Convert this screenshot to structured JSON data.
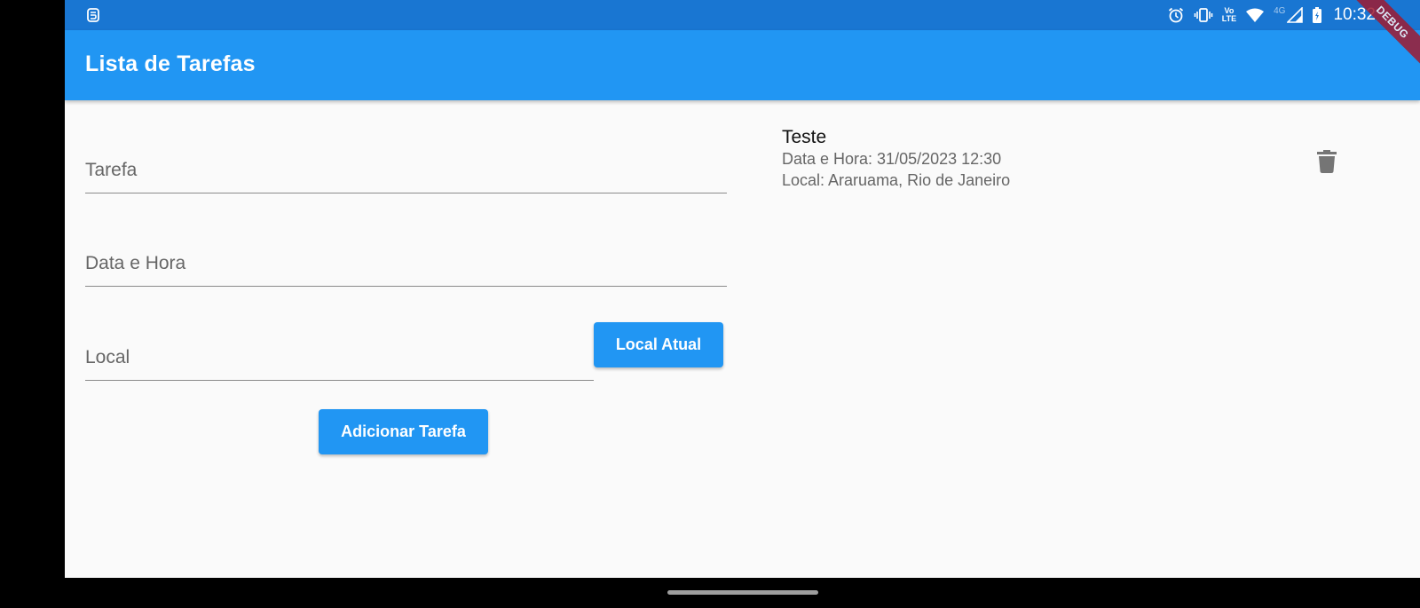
{
  "statusbar": {
    "time": "10:32",
    "lte_top": "Vo",
    "lte_bottom": "LTE",
    "network": "4G"
  },
  "debug_banner": "DEBUG",
  "appbar": {
    "title": "Lista de Tarefas"
  },
  "form": {
    "tarefa_label": "Tarefa",
    "data_hora_label": "Data e Hora",
    "local_label": "Local",
    "local_atual_button": "Local Atual",
    "adicionar_button": "Adicionar Tarefa"
  },
  "tasks": [
    {
      "title": "Teste",
      "datetime": "Data e Hora: 31/05/2023 12:30",
      "location": "Local: Araruama, Rio de Janeiro"
    }
  ],
  "colors": {
    "primary": "#2196f3",
    "statusbar": "#1976d2",
    "background": "#fafafa"
  }
}
